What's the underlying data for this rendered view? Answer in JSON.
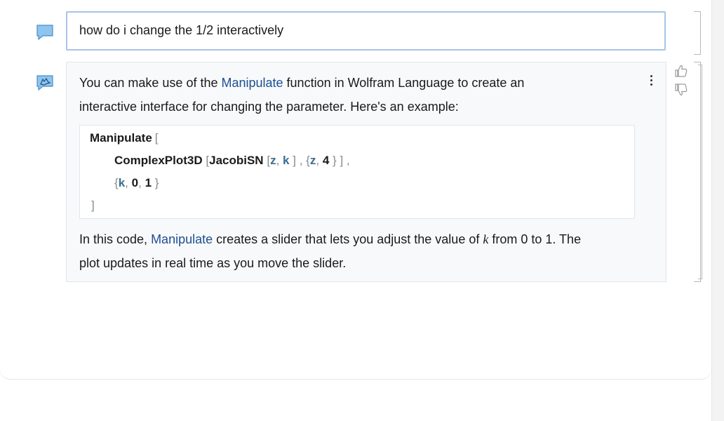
{
  "user_message": {
    "text": "how do i change the 1/2 interactively"
  },
  "assistant_message": {
    "para1_a": "You can make use of the ",
    "para1_link": "Manipulate",
    "para1_b": " function in Wolfram Language to create an",
    "para1_line2": "interactive interface for changing the parameter. Here's an example:",
    "code": {
      "line1_fn": "Manipulate",
      "line1_open": "[",
      "line2_fn": "ComplexPlot3D",
      "line2_open": "[",
      "line2_inner_fn": "JacobiSN",
      "line2_inner_open": "[",
      "line2_z": "z",
      "line2_comma1": ",",
      "line2_k": "k",
      "line2_inner_close": "]",
      "line2_comma2": ",",
      "line2_brace_open": "{",
      "line2_z2": "z",
      "line2_comma3": ",",
      "line2_four": "4",
      "line2_brace_close": "}",
      "line2_close": "]",
      "line2_comma4": ",",
      "line3_brace_open": "{",
      "line3_k": "k",
      "line3_comma1": ",",
      "line3_zero": "0",
      "line3_comma2": ",",
      "line3_one": "1",
      "line3_brace_close": "}",
      "line4_close": "]"
    },
    "para2_a": "In this code, ",
    "para2_link": "Manipulate",
    "para2_b": " creates a slider that lets you adjust the value of ",
    "para2_var": "k",
    "para2_c": " from 0 to 1. The",
    "para2_line2": "plot updates in real time as you move the slider."
  },
  "icons": {
    "user": "chat-bubble-icon",
    "assistant": "wolf-chat-icon",
    "thumbs_up": "thumbs-up-icon",
    "thumbs_down": "thumbs-down-icon",
    "menu": "vertical-dots-icon"
  },
  "colors": {
    "link": "#1d4f91",
    "user_border": "#a9c4e8",
    "icon_fill": "#8ec5ef"
  }
}
